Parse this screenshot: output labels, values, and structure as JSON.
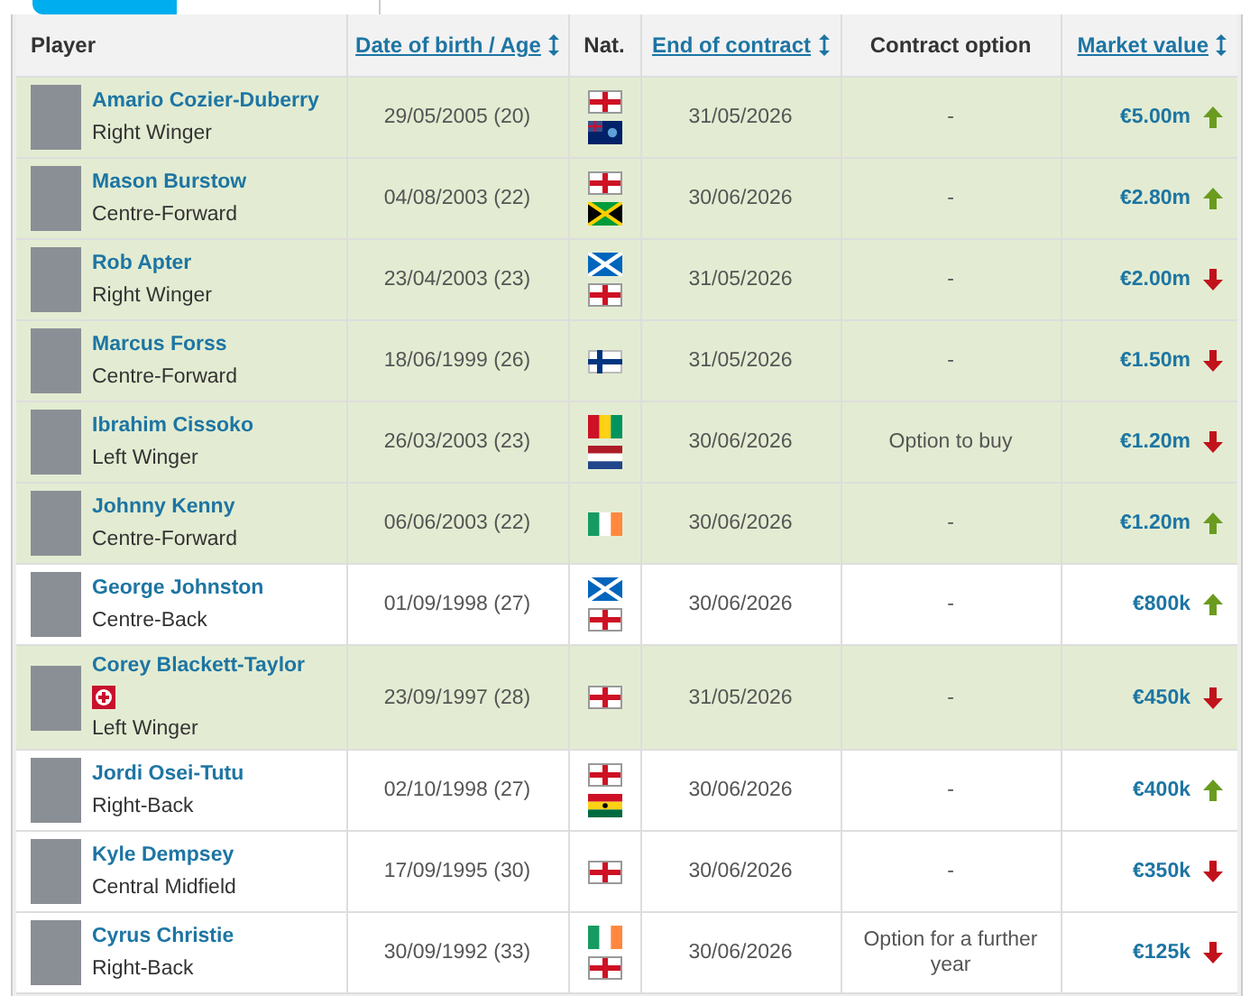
{
  "tabs": [
    {
      "selected": true
    },
    {
      "selected": false
    }
  ],
  "columns": [
    {
      "label": "Player",
      "sortable": false
    },
    {
      "label": "Date of birth / Age",
      "sortable": true
    },
    {
      "label": "Nat.",
      "sortable": false
    },
    {
      "label": "End of contract",
      "sortable": true
    },
    {
      "label": "Contract option",
      "sortable": false
    },
    {
      "label": "Market value",
      "sortable": true
    }
  ],
  "rows": [
    {
      "name": "Amario Cozier-Duberry",
      "position": "Right Winger",
      "injured": false,
      "dob": "29/05/2005 (20)",
      "flags": [
        {
          "kind": "eng"
        },
        {
          "kind": "msr"
        }
      ],
      "contract": "31/05/2026",
      "option": "-",
      "value": "€5.00m",
      "rising": true,
      "highlighted": true
    },
    {
      "name": "Mason Burstow",
      "position": "Centre-Forward",
      "injured": false,
      "dob": "04/08/2003 (22)",
      "flags": [
        {
          "kind": "eng"
        },
        {
          "kind": "jam"
        }
      ],
      "contract": "30/06/2026",
      "option": "-",
      "value": "€2.80m",
      "rising": true,
      "highlighted": true
    },
    {
      "name": "Rob Apter",
      "position": "Right Winger",
      "injured": false,
      "dob": "23/04/2003 (23)",
      "flags": [
        {
          "kind": "sco"
        },
        {
          "kind": "eng"
        }
      ],
      "contract": "31/05/2026",
      "option": "-",
      "value": "€2.00m",
      "rising": false,
      "highlighted": true
    },
    {
      "name": "Marcus Forss",
      "position": "Centre-Forward",
      "injured": false,
      "dob": "18/06/1999 (26)",
      "flags": [
        {
          "kind": "fin"
        }
      ],
      "contract": "31/05/2026",
      "option": "-",
      "value": "€1.50m",
      "rising": false,
      "highlighted": true
    },
    {
      "name": "Ibrahim Cissoko",
      "position": "Left Winger",
      "injured": false,
      "dob": "26/03/2003 (23)",
      "flags": [
        {
          "kind": "gui"
        },
        {
          "kind": "ned"
        }
      ],
      "contract": "30/06/2026",
      "option": "Option to buy",
      "value": "€1.20m",
      "rising": false,
      "highlighted": true
    },
    {
      "name": "Johnny Kenny",
      "position": "Centre-Forward",
      "injured": false,
      "dob": "06/06/2003 (22)",
      "flags": [
        {
          "kind": "irl"
        }
      ],
      "contract": "30/06/2026",
      "option": "-",
      "value": "€1.20m",
      "rising": true,
      "highlighted": true
    },
    {
      "name": "George Johnston",
      "position": "Centre-Back",
      "injured": false,
      "dob": "01/09/1998 (27)",
      "flags": [
        {
          "kind": "sco"
        },
        {
          "kind": "eng"
        }
      ],
      "contract": "30/06/2026",
      "option": "-",
      "value": "€800k",
      "rising": true,
      "highlighted": false
    },
    {
      "name": "Corey Blackett-Taylor",
      "position": "Left Winger",
      "injured": true,
      "dob": "23/09/1997 (28)",
      "flags": [
        {
          "kind": "eng"
        }
      ],
      "contract": "31/05/2026",
      "option": "-",
      "value": "€450k",
      "rising": false,
      "highlighted": true
    },
    {
      "name": "Jordi Osei-Tutu",
      "position": "Right-Back",
      "injured": false,
      "dob": "02/10/1998 (27)",
      "flags": [
        {
          "kind": "eng"
        },
        {
          "kind": "gha"
        }
      ],
      "contract": "30/06/2026",
      "option": "-",
      "value": "€400k",
      "rising": true,
      "highlighted": false
    },
    {
      "name": "Kyle Dempsey",
      "position": "Central Midfield",
      "injured": false,
      "dob": "17/09/1995 (30)",
      "flags": [
        {
          "kind": "eng"
        }
      ],
      "contract": "30/06/2026",
      "option": "-",
      "value": "€350k",
      "rising": false,
      "highlighted": false
    },
    {
      "name": "Cyrus Christie",
      "position": "Right-Back",
      "injured": false,
      "dob": "30/09/1992 (33)",
      "flags": [
        {
          "kind": "irl"
        },
        {
          "kind": "eng"
        }
      ],
      "contract": "30/06/2026",
      "option": "Option for a further year",
      "value": "€125k",
      "rising": false,
      "highlighted": false
    }
  ]
}
